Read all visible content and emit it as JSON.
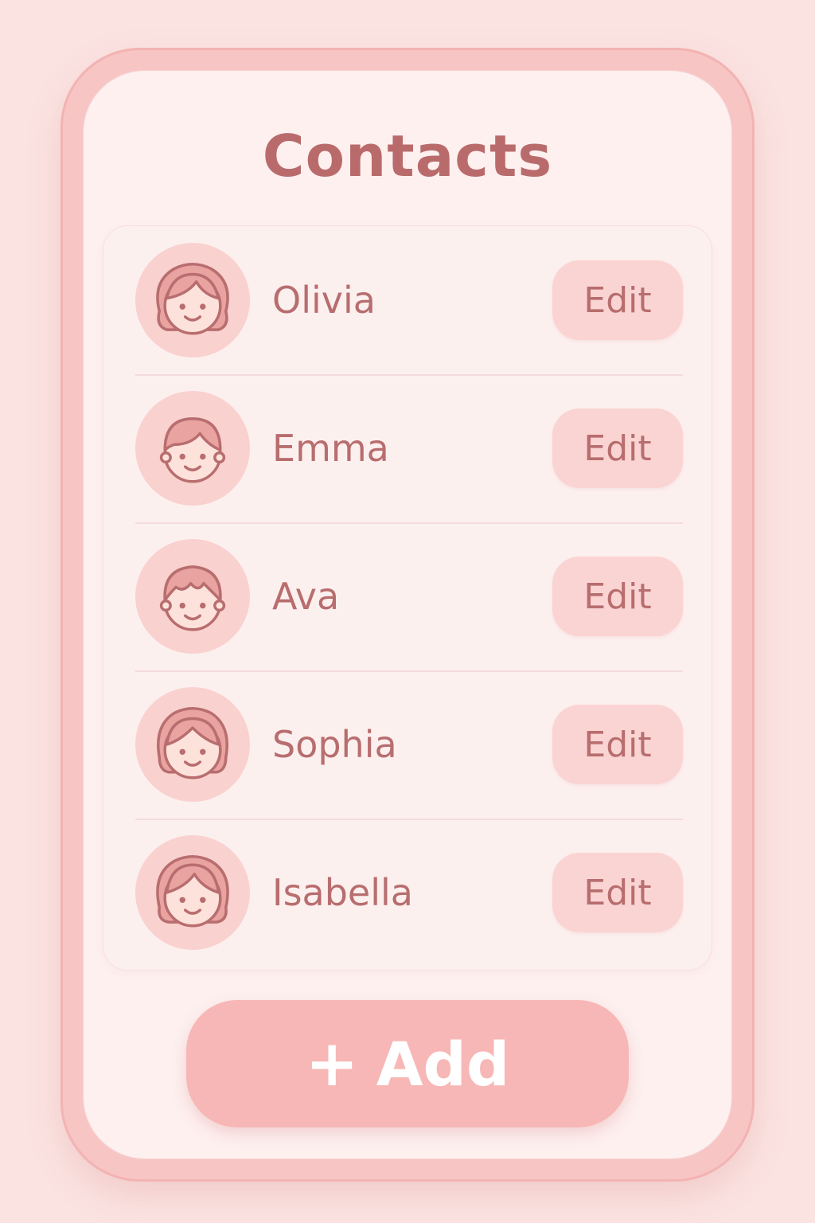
{
  "app": {
    "title": "Contacts"
  },
  "contacts": [
    {
      "name": "Olivia",
      "edit_label": "Edit",
      "avatar_icon": "girl-face-icon"
    },
    {
      "name": "Emma",
      "edit_label": "Edit",
      "avatar_icon": "girl-face-icon"
    },
    {
      "name": "Ava",
      "edit_label": "Edit",
      "avatar_icon": "girl-face-icon"
    },
    {
      "name": "Sophia",
      "edit_label": "Edit",
      "avatar_icon": "girl-face-icon"
    },
    {
      "name": "Isabella",
      "edit_label": "Edit",
      "avatar_icon": "girl-face-icon"
    }
  ],
  "actions": {
    "add_icon": "plus-icon",
    "add_label": "Add"
  },
  "colors": {
    "background": "#fbe3e1",
    "screen": "#fdf0ef",
    "text": "#b96b6b",
    "button": "#fad4d3",
    "accent": "#f7b7b6"
  }
}
